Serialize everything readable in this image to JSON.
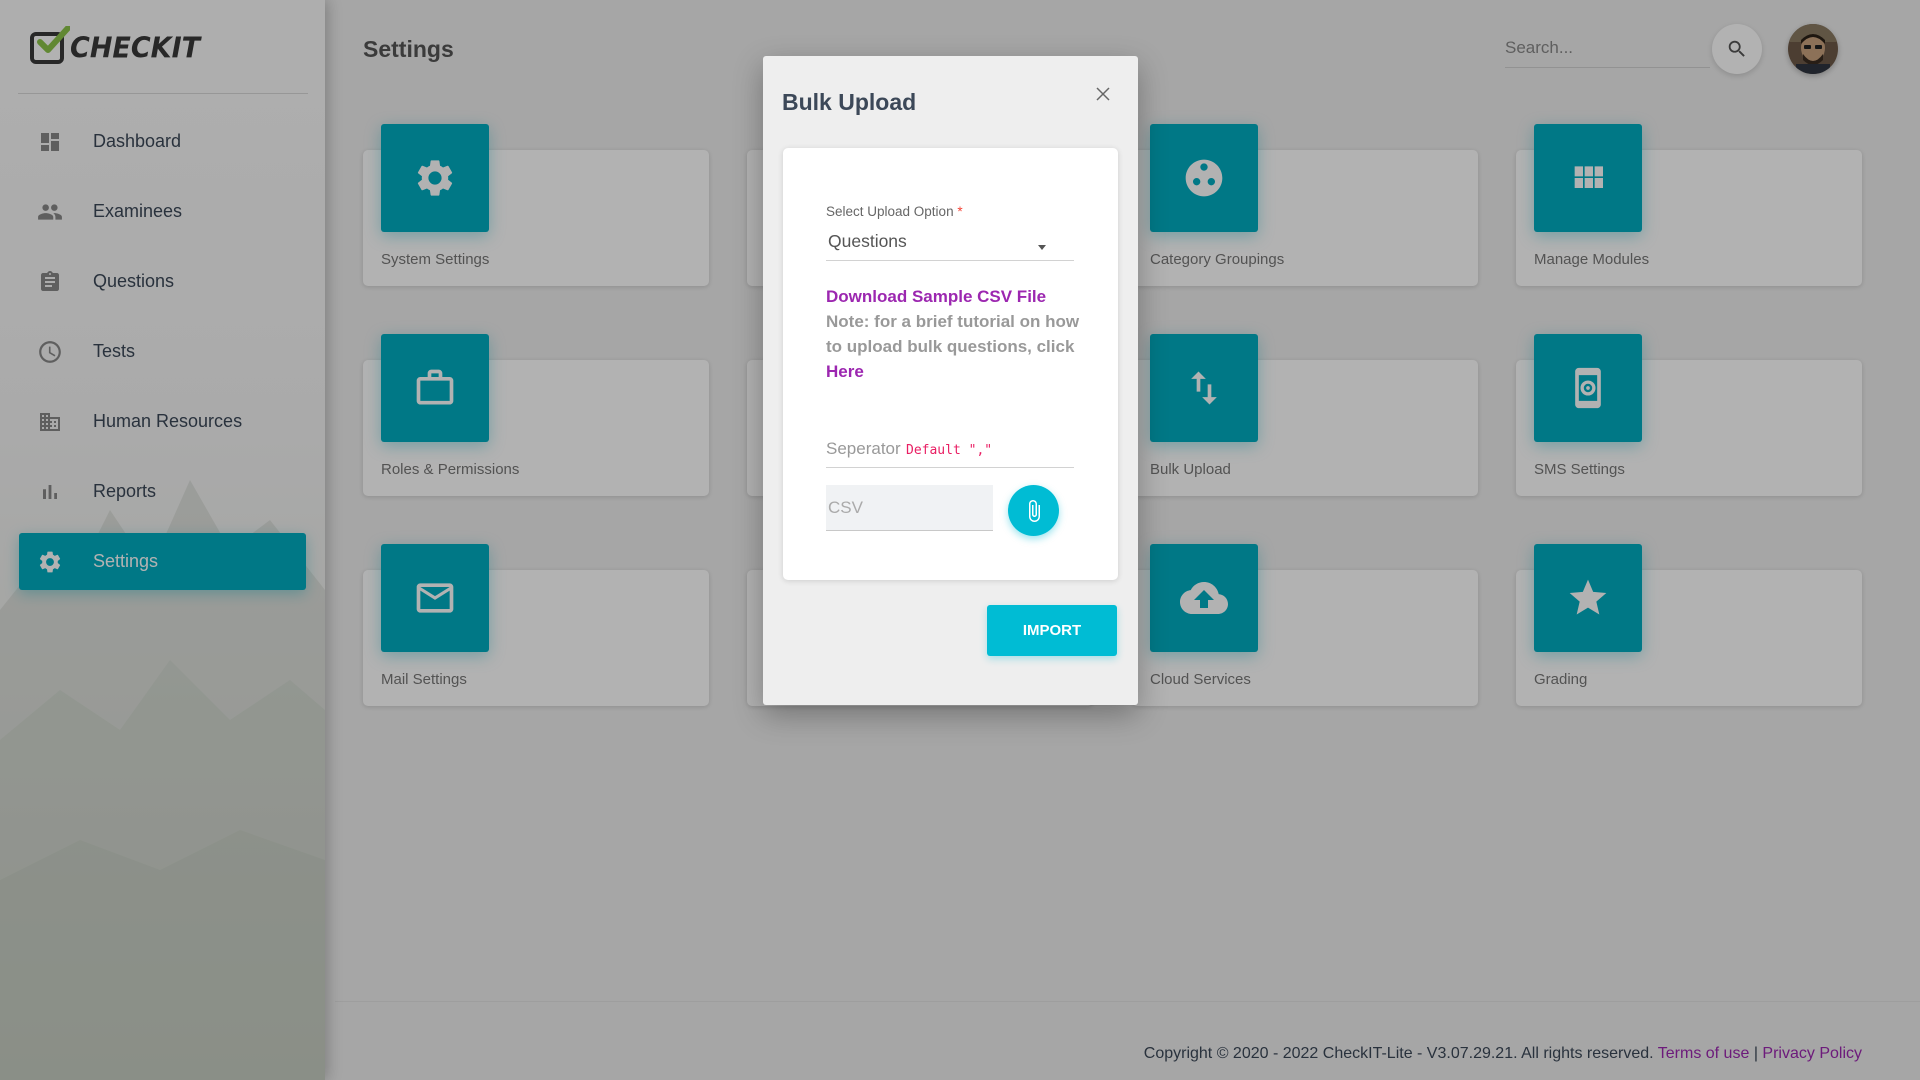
{
  "app": {
    "logo_text": "CHECKIT",
    "page_title": "Settings"
  },
  "sidebar": {
    "items": [
      {
        "label": "Dashboard",
        "icon": "dashboard-icon",
        "active": false
      },
      {
        "label": "Examinees",
        "icon": "people-icon",
        "active": false
      },
      {
        "label": "Questions",
        "icon": "clipboard-icon",
        "active": false
      },
      {
        "label": "Tests",
        "icon": "clock-icon",
        "active": false
      },
      {
        "label": "Human Resources",
        "icon": "building-icon",
        "active": false
      },
      {
        "label": "Reports",
        "icon": "bar-chart-icon",
        "active": false
      },
      {
        "label": "Settings",
        "icon": "gear-icon",
        "active": true
      }
    ]
  },
  "header": {
    "search_placeholder": "Search..."
  },
  "cards": [
    {
      "label": "System Settings",
      "icon": "gear-icon"
    },
    {
      "label": "Category Groupings",
      "icon": "group-icon"
    },
    {
      "label": "Manage Modules",
      "icon": "apps-grid-icon"
    },
    {
      "label": "Roles & Permissions",
      "icon": "briefcase-icon"
    },
    {
      "label": "Bulk Upload",
      "icon": "swap-vertical-icon"
    },
    {
      "label": "SMS Settings",
      "icon": "phone-settings-icon"
    },
    {
      "label": "Mail Settings",
      "icon": "mail-icon"
    },
    {
      "label": "Cloud Services",
      "icon": "cloud-upload-icon"
    },
    {
      "label": "Grading",
      "icon": "star-icon"
    }
  ],
  "modal": {
    "title": "Bulk Upload",
    "select_label": "Select Upload Option",
    "required_mark": "*",
    "select_value": "Questions",
    "download_link": "Download Sample CSV File",
    "note_text": "Note: for a brief tutorial on how to upload bulk questions, click",
    "here_link": "Here",
    "separator_label": "Seperator",
    "separator_default": "Default \",\"",
    "csv_placeholder": "CSV",
    "import_label": "IMPORT"
  },
  "footer": {
    "copyright": "Copyright © 2020 - 2022 CheckIT-Lite - V3.07.29.21. All rights reserved.",
    "terms_link": "Terms of use",
    "divider": "|",
    "privacy_link": "Privacy Policy"
  },
  "colors": {
    "accent": "#00acc1",
    "link": "#9c27b0",
    "required": "#f44336",
    "separator_default": "#e91e63"
  }
}
